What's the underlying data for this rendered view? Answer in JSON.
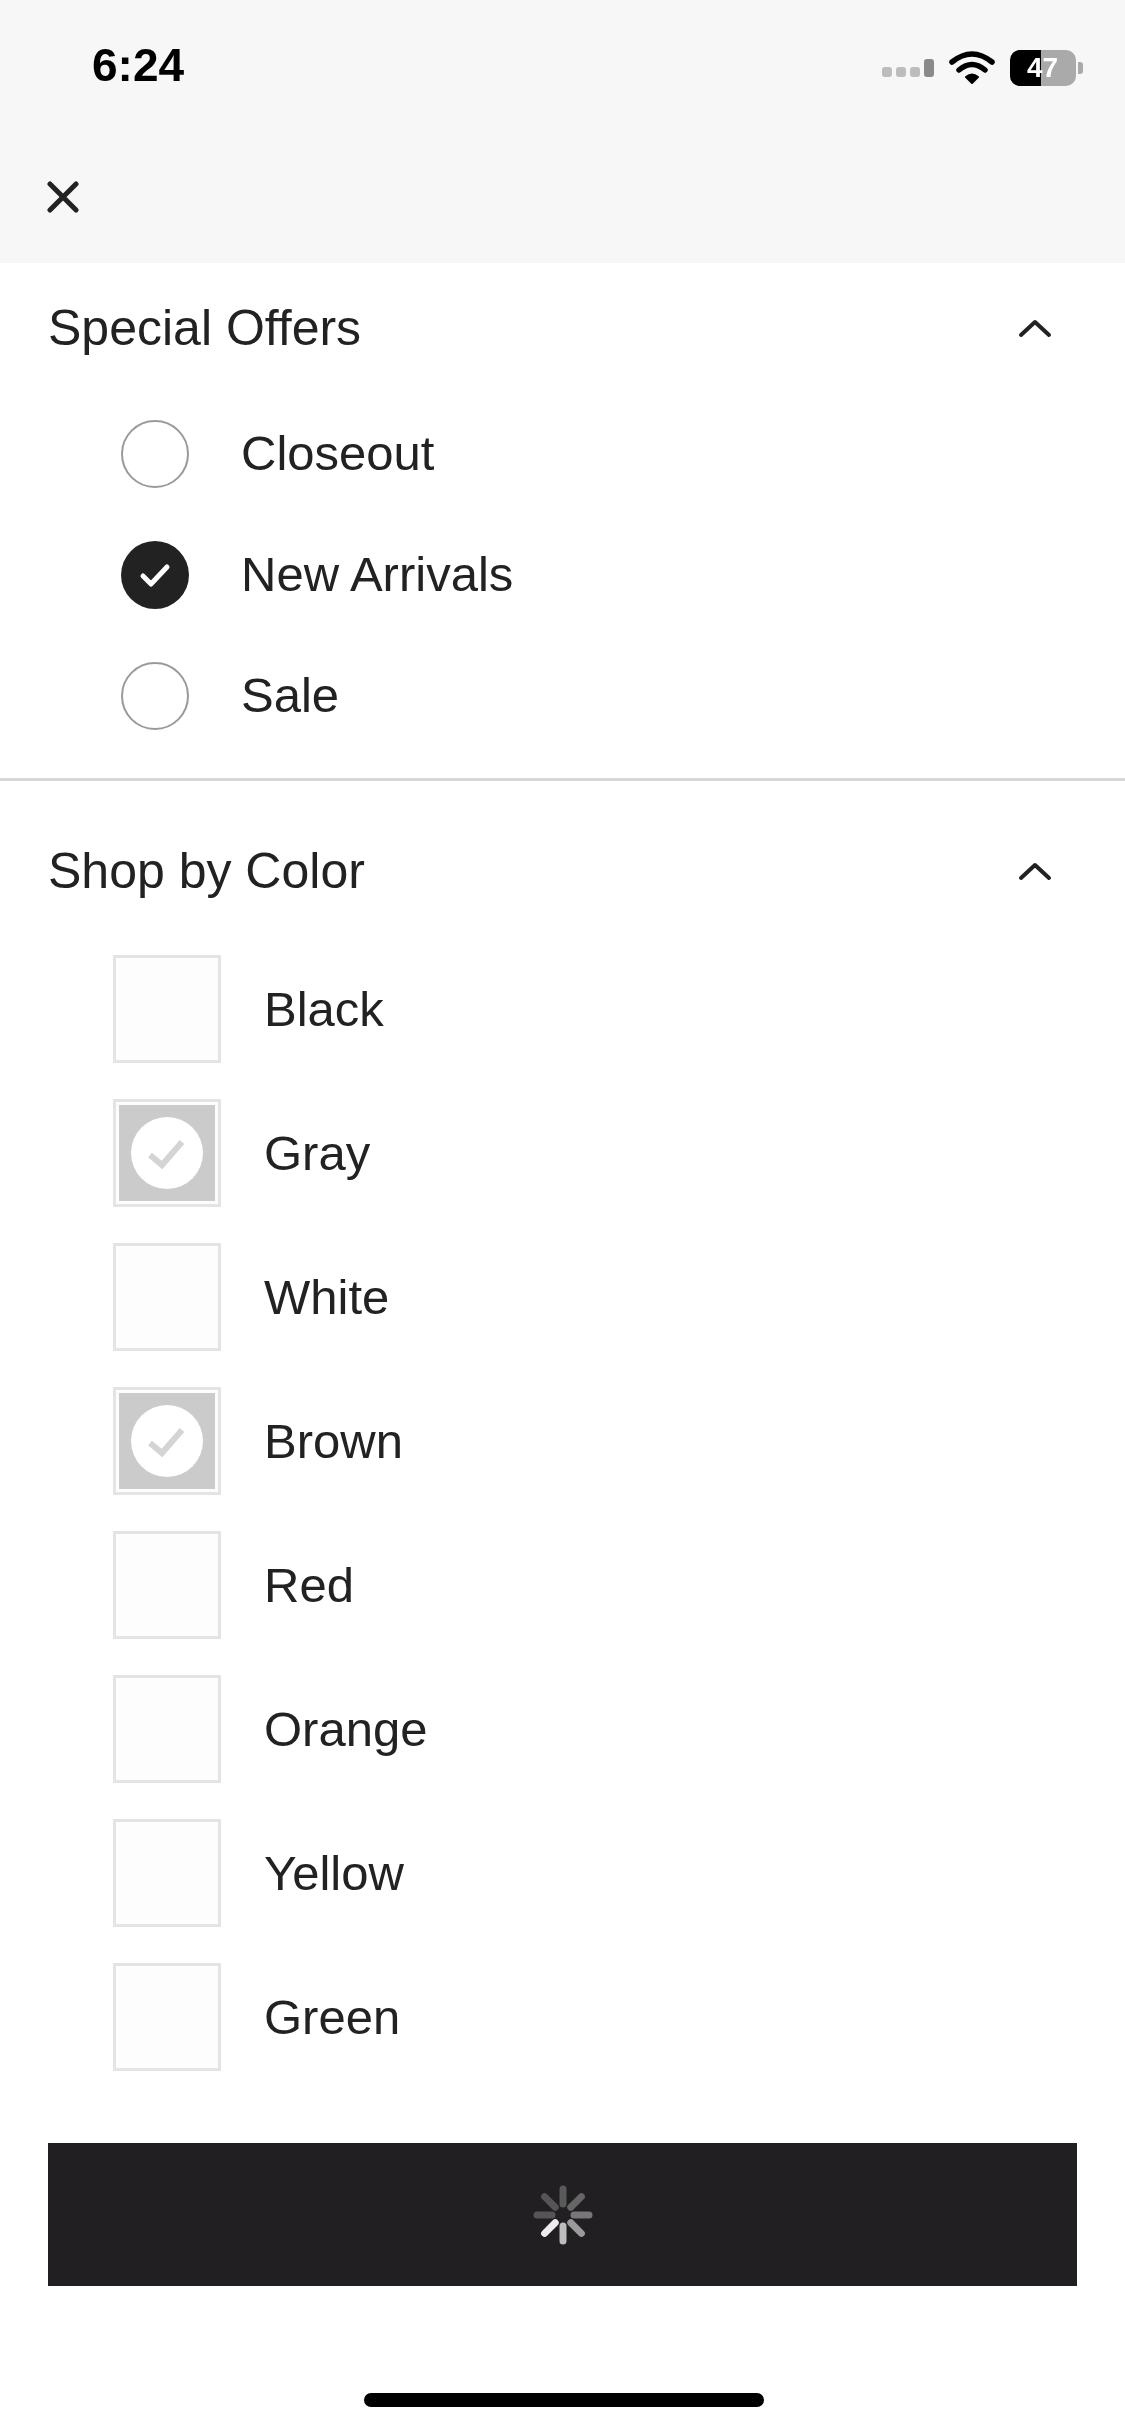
{
  "status_bar": {
    "time": "6:24",
    "battery": "47"
  },
  "sections": [
    {
      "title": "Special Offers",
      "expanded": true,
      "kind": "radio",
      "options": [
        {
          "label": "Closeout",
          "selected": false
        },
        {
          "label": "New Arrivals",
          "selected": true
        },
        {
          "label": "Sale",
          "selected": false
        }
      ]
    },
    {
      "title": "Shop by Color",
      "expanded": true,
      "kind": "checkbox",
      "options": [
        {
          "label": "Black",
          "checked": false
        },
        {
          "label": "Gray",
          "checked": true
        },
        {
          "label": "White",
          "checked": false
        },
        {
          "label": "Brown",
          "checked": true
        },
        {
          "label": "Red",
          "checked": false
        },
        {
          "label": "Orange",
          "checked": false
        },
        {
          "label": "Yellow",
          "checked": false
        },
        {
          "label": "Green",
          "checked": false
        }
      ]
    }
  ],
  "apply_button": {
    "loading": true
  }
}
